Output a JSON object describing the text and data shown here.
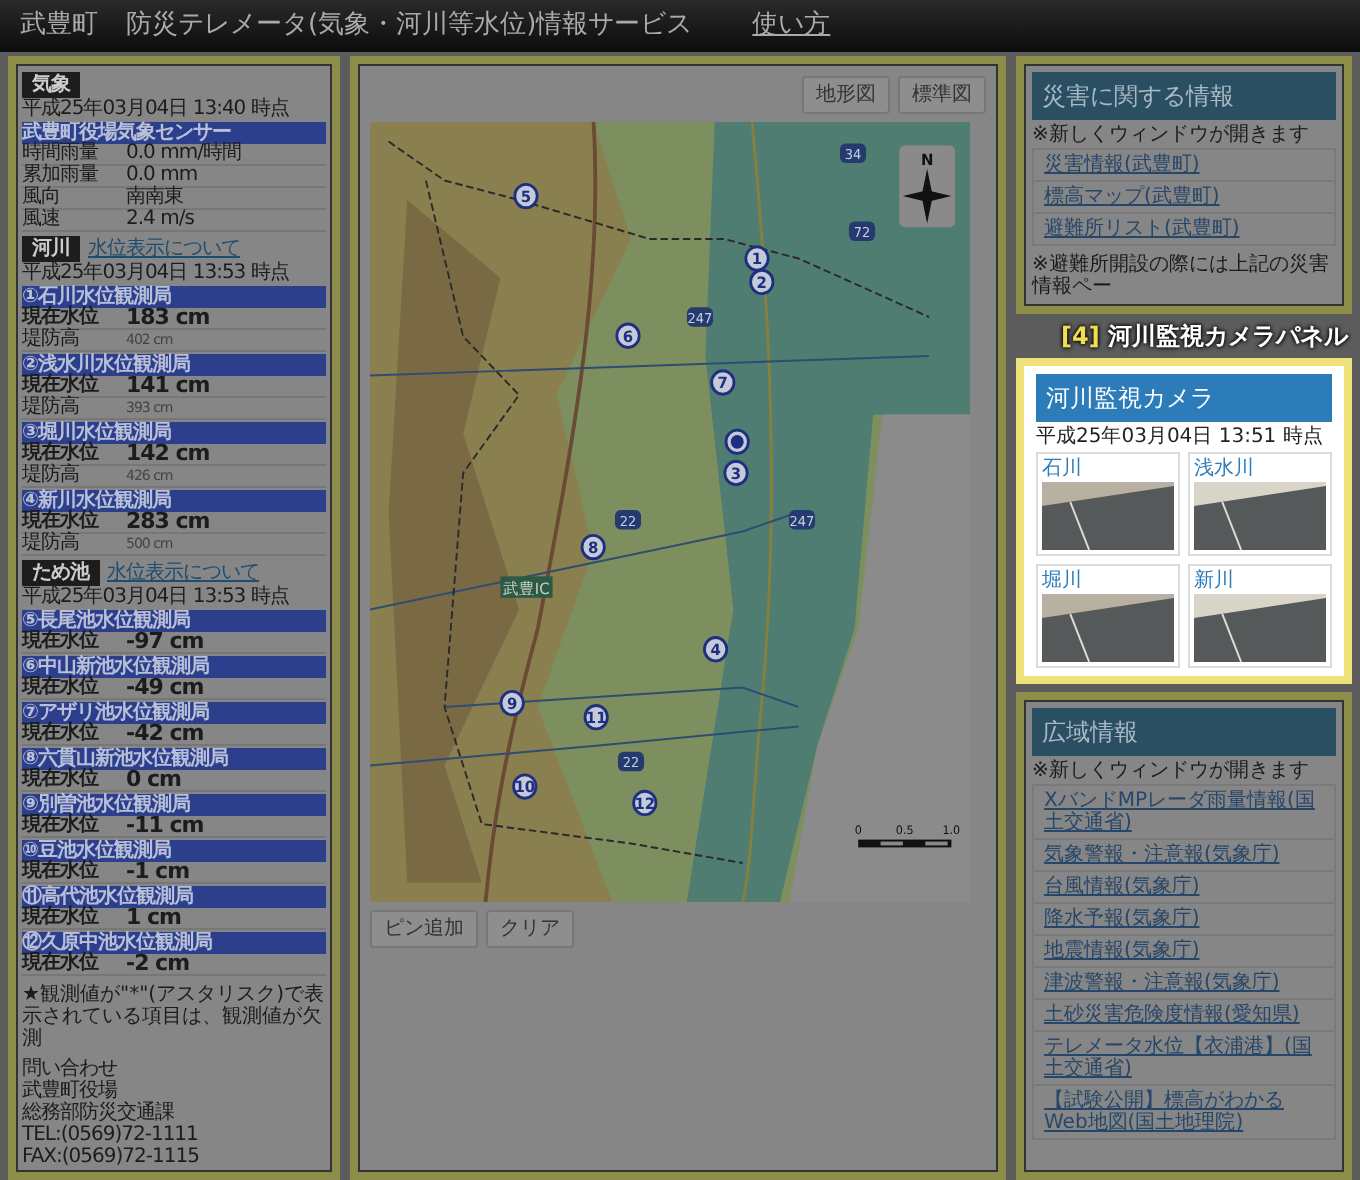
{
  "header": {
    "town": "武豊町",
    "title": "防災テレメータ(気象・河川等水位)情報サービス",
    "help_link": "使い方"
  },
  "weather": {
    "heading": "気象",
    "time": "平成25年03月04日 13:40 時点",
    "station": "武豊町役場気象センサー",
    "rows": [
      {
        "label": "時間雨量",
        "value": "0.0 mm/時間"
      },
      {
        "label": "累加雨量",
        "value": "0.0 mm"
      },
      {
        "label": "風向",
        "value": "南南東"
      },
      {
        "label": "風速",
        "value": "2.4 m/s"
      }
    ]
  },
  "river": {
    "heading": "河川",
    "link": "水位表示について",
    "time": "平成25年03月04日 13:53 時点",
    "stations": [
      {
        "name": "①石川水位観測局",
        "level_label": "現在水位",
        "level": "183 cm",
        "bank_label": "堤防高",
        "bank": "402 cm"
      },
      {
        "name": "②浅水川水位観測局",
        "level_label": "現在水位",
        "level": "141 cm",
        "bank_label": "堤防高",
        "bank": "393 cm"
      },
      {
        "name": "③堀川水位観測局",
        "level_label": "現在水位",
        "level": "142 cm",
        "bank_label": "堤防高",
        "bank": "426 cm"
      },
      {
        "name": "④新川水位観測局",
        "level_label": "現在水位",
        "level": "283 cm",
        "bank_label": "堤防高",
        "bank": "500 cm"
      }
    ]
  },
  "ponds": {
    "heading": "ため池",
    "link": "水位表示について",
    "time": "平成25年03月04日 13:53 時点",
    "stations": [
      {
        "name": "⑤長尾池水位観測局",
        "level_label": "現在水位",
        "level": "-97 cm"
      },
      {
        "name": "⑥中山新池水位観測局",
        "level_label": "現在水位",
        "level": "-49 cm"
      },
      {
        "name": "⑦アザリ池水位観測局",
        "level_label": "現在水位",
        "level": "-42 cm"
      },
      {
        "name": "⑧六貫山新池水位観測局",
        "level_label": "現在水位",
        "level": "0 cm"
      },
      {
        "name": "⑨別曽池水位観測局",
        "level_label": "現在水位",
        "level": "-11 cm"
      },
      {
        "name": "⑩豆池水位観測局",
        "level_label": "現在水位",
        "level": "-1 cm"
      },
      {
        "name": "⑪高代池水位観測局",
        "level_label": "現在水位",
        "level": "1 cm"
      },
      {
        "name": "⑫久原中池水位観測局",
        "level_label": "現在水位",
        "level": "-2 cm"
      }
    ]
  },
  "note": "★観測値が\"*\"(アスタリスク)で表示されている項目は、観測値が欠測",
  "contact": [
    "問い合わせ",
    "武豊町役場",
    "総務部防災交通課",
    "TEL:(0569)72-1111",
    "FAX:(0569)72-1115"
  ],
  "map": {
    "layer_buttons": [
      "地形図",
      "標準図"
    ],
    "markers": [
      {
        "kind": "numbered",
        "label": "5"
      },
      {
        "kind": "numbered",
        "label": "1"
      },
      {
        "kind": "numbered",
        "label": "2"
      },
      {
        "kind": "numbered",
        "label": "6"
      },
      {
        "kind": "numbered",
        "label": "7"
      },
      {
        "kind": "dot"
      },
      {
        "kind": "numbered",
        "label": "3"
      },
      {
        "kind": "numbered",
        "label": "8"
      },
      {
        "kind": "numbered",
        "label": "4"
      },
      {
        "kind": "numbered",
        "label": "9"
      },
      {
        "kind": "numbered",
        "label": "11"
      },
      {
        "kind": "numbered",
        "label": "10"
      },
      {
        "kind": "numbered",
        "label": "12"
      }
    ],
    "shields": [
      "34",
      "72",
      "247",
      "22",
      "247",
      "22"
    ],
    "ic_label": "武豊IC",
    "compass_label": "N",
    "scale_labels": [
      "0",
      "0.5",
      "1.0"
    ],
    "action_buttons": [
      "ピン追加",
      "クリア"
    ]
  },
  "disaster": {
    "heading": "災害に関する情報",
    "note": "※新しくウィンドウが開きます",
    "links": [
      "災害情報(武豊町)",
      "標高マップ(武豊町)",
      "避難所リスト(武豊町)"
    ],
    "footnote": "※避難所開設の際には上記の災害情報ペー"
  },
  "callout": {
    "number": "[4]",
    "text": "河川監視カメラパネル"
  },
  "cameras": {
    "heading": "河川監視カメラ",
    "time": "平成25年03月04日 13:51 時点",
    "items": [
      {
        "name": "石川"
      },
      {
        "name": "浅水川"
      },
      {
        "name": "堀川"
      },
      {
        "name": "新川"
      }
    ]
  },
  "regional": {
    "heading": "広域情報",
    "note": "※新しくウィンドウが開きます",
    "links": [
      "XバンドMPレーダ雨量情報(国土交通省)",
      "気象警報・注意報(気象庁)",
      "台風情報(気象庁)",
      "降水予報(気象庁)",
      "地震情報(気象庁)",
      "津波警報・注意報(気象庁)",
      "土砂災害危険度情報(愛知県)",
      "テレメータ水位【衣浦港】(国土交通省)",
      "【試験公開】標高がわかるWeb地図(国土地理院)"
    ]
  }
}
